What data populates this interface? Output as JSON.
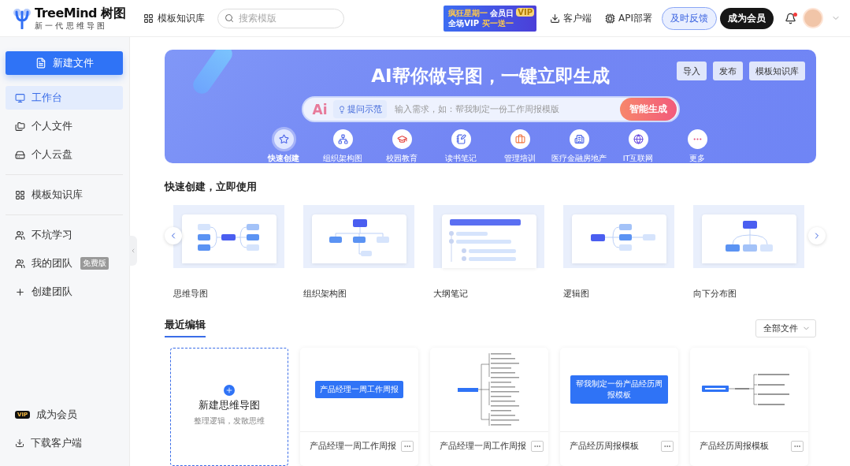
{
  "header": {
    "logo": {
      "name": "TreeMind",
      "name_cn": "树图",
      "tagline": "新 一 代 思 维 导 图"
    },
    "nav_link": "模板知识库",
    "search": {
      "placeholder": "搜索模版"
    },
    "promo": {
      "line1a": "疯狂星期一",
      "line1b": "会员日",
      "line2a": "全场VIP",
      "line2b": "买一送一",
      "badge": "VIP"
    },
    "client": "客户端",
    "api": "API部署",
    "feedback": "及时反馈",
    "member": "成为会员",
    "has_unread": true
  },
  "sidebar": {
    "new_file": "新建文件",
    "sections": [
      [
        {
          "label": "工作台",
          "selected": true
        },
        {
          "label": "个人文件",
          "selected": false
        },
        {
          "label": "个人云盘",
          "selected": false
        }
      ],
      [
        {
          "label": "模板知识库",
          "selected": false
        }
      ],
      [
        {
          "label": "不坑学习",
          "selected": false
        },
        {
          "label": "我的团队",
          "selected": false,
          "badge": "免费版"
        },
        {
          "label": "创建团队",
          "selected": false
        }
      ]
    ],
    "vip": {
      "badge": "VIP",
      "label": "成为会员"
    },
    "download": "下载客户端"
  },
  "banner": {
    "title": "AI帮你做导图，一键立即生成",
    "buttons": [
      "导入",
      "发布",
      "模板知识库"
    ],
    "ai_logo": "Ai",
    "hint_chip": "提问示范",
    "placeholder": "输入需求，如：帮我制定一份工作周报模版",
    "generate": "智能生成",
    "categories": [
      {
        "label": "快速创建",
        "selected": true
      },
      {
        "label": "组织架构图",
        "selected": false
      },
      {
        "label": "校园教育",
        "selected": false
      },
      {
        "label": "读书笔记",
        "selected": false
      },
      {
        "label": "管理培训",
        "selected": false
      },
      {
        "label": "医疗金融房地产",
        "selected": false
      },
      {
        "label": "IT互联网",
        "selected": false
      },
      {
        "label": "更多",
        "selected": false
      }
    ]
  },
  "quick_create": {
    "title": "快速创建，立即使用",
    "templates": [
      {
        "label": "思维导图",
        "kind": "mindmap"
      },
      {
        "label": "组织架构图",
        "kind": "org"
      },
      {
        "label": "大纲笔记",
        "kind": "outline"
      },
      {
        "label": "逻辑图",
        "kind": "logic"
      },
      {
        "label": "向下分布图",
        "kind": "down"
      }
    ]
  },
  "recent": {
    "title": "最近编辑",
    "filter": "全部文件",
    "new_card": {
      "title": "新建思维导图",
      "subtitle": "整理逻辑，发散思维"
    },
    "files": [
      {
        "title": "产品经理一周工作周报",
        "preview": {
          "kind": "node",
          "text": "产品经理一周工作周报"
        }
      },
      {
        "title": "产品经理一周工作周报",
        "preview": {
          "kind": "tree"
        }
      },
      {
        "title": "产品经历周报模板",
        "preview": {
          "kind": "node",
          "text": "帮我制定一份产品经历周报模板"
        }
      },
      {
        "title": "产品经历周报模板",
        "preview": {
          "kind": "branch"
        }
      }
    ]
  }
}
